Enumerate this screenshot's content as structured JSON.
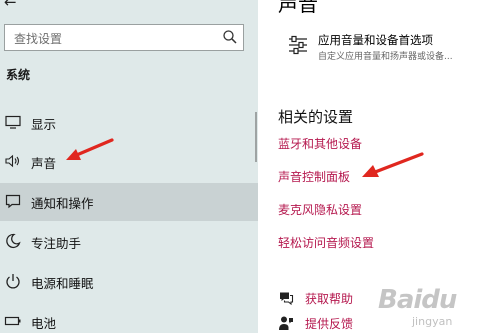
{
  "sidebar": {
    "search": {
      "placeholder": "查找设置"
    },
    "section_title": "系统",
    "items": [
      {
        "label": "显示",
        "icon": "monitor-icon"
      },
      {
        "label": "声音",
        "icon": "speaker-icon"
      },
      {
        "label": "通知和操作",
        "icon": "notification-icon"
      },
      {
        "label": "专注助手",
        "icon": "moon-icon"
      },
      {
        "label": "电源和睡眠",
        "icon": "power-icon"
      },
      {
        "label": "电池",
        "icon": "battery-icon"
      }
    ],
    "hovered_item": "通知和操作"
  },
  "content": {
    "heading": "声音",
    "device_options": {
      "title": "应用音量和设备首选项",
      "description": "自定义应用音量和扬声器或设备..."
    },
    "related_heading": "相关的设置",
    "related_links": [
      "蓝牙和其他设备",
      "声音控制面板",
      "麦克风隐私设置",
      "轻松访问音频设置"
    ],
    "help": [
      {
        "label": "获取帮助",
        "icon": "help-chat-icon"
      },
      {
        "label": "提供反馈",
        "icon": "feedback-icon"
      }
    ]
  },
  "watermark": {
    "text": "Baidu",
    "sub": "jingyan"
  },
  "colors": {
    "sidebar_bg": "#dfe9e9",
    "link": "#b5184e",
    "arrow": "#e0271f",
    "hover": "#c9d2d3"
  }
}
